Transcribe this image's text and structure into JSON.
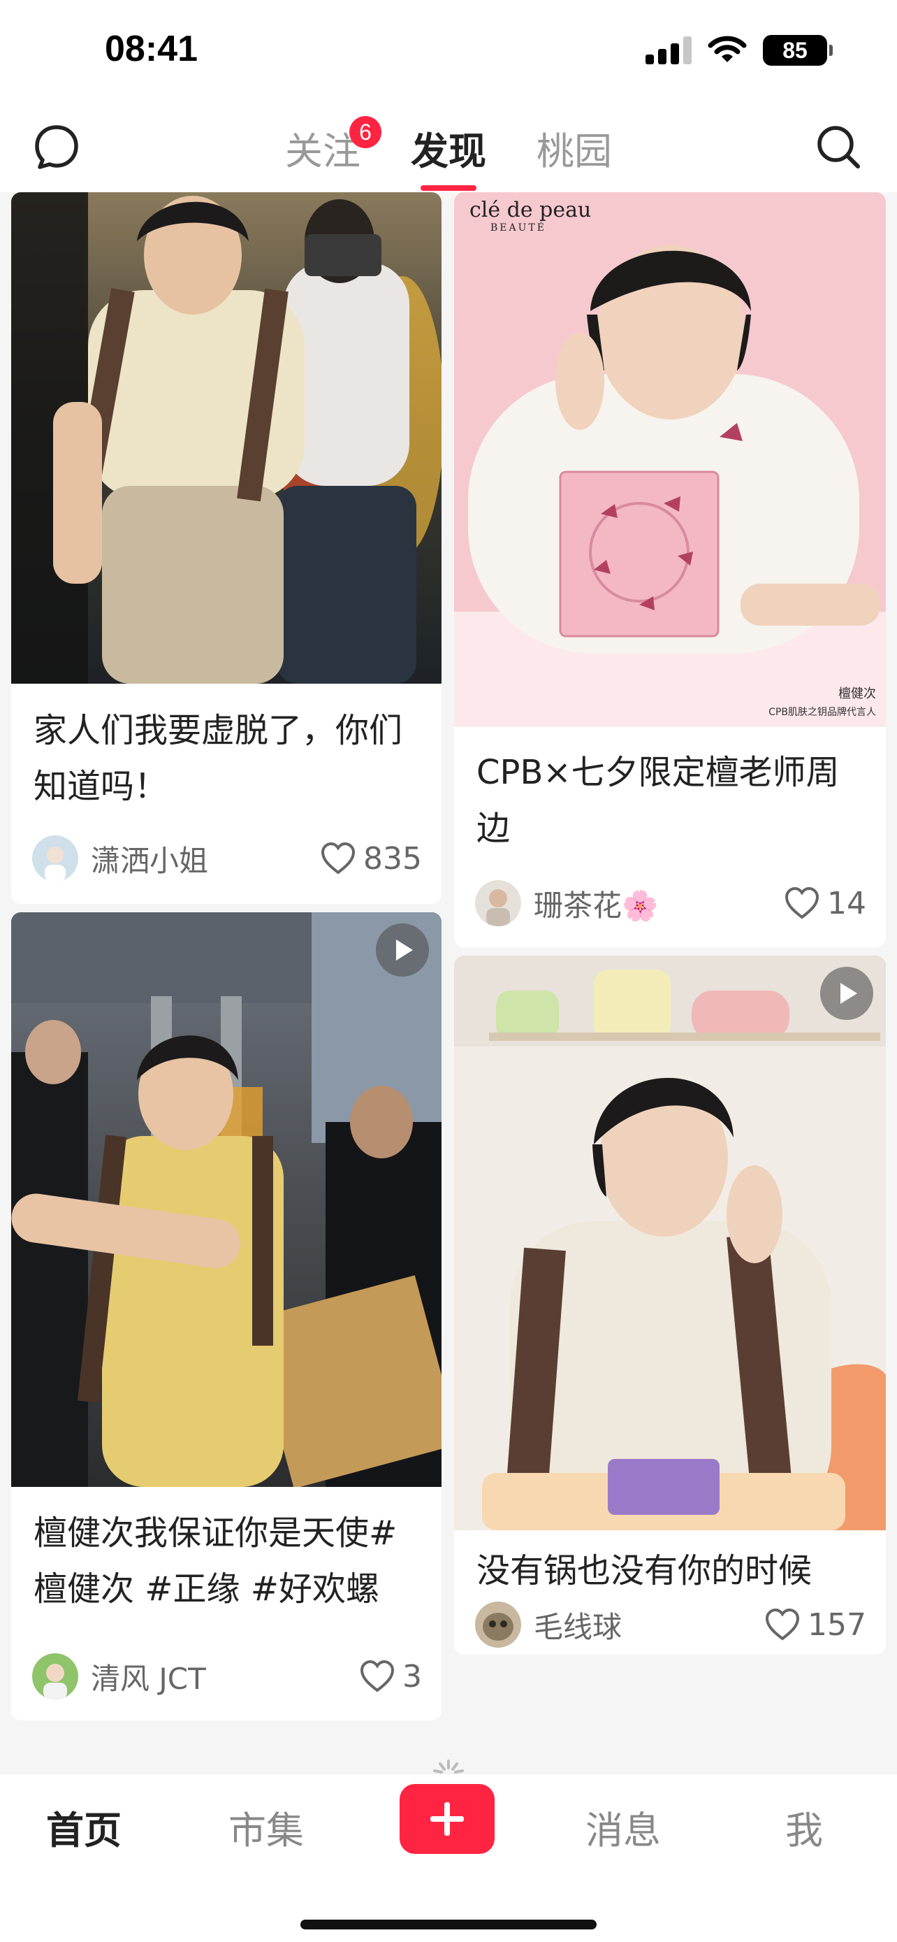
{
  "status_bar": {
    "time": "08:41",
    "battery": "85"
  },
  "top_nav": {
    "tabs": [
      {
        "label": "关注",
        "badge": "6"
      },
      {
        "label": "发现"
      },
      {
        "label": "桃园"
      }
    ],
    "active_tab": "发现"
  },
  "feed": {
    "posts": [
      {
        "title": "家人们我要虚脱了，你们知道吗！",
        "author": "潇洒小姐",
        "likes": "835",
        "video": false
      },
      {
        "brand_logo": "clé de peau",
        "brand_sub": "BEAUTÉ",
        "image_caption_1": "檀健次",
        "image_caption_2": "CPB肌肤之钥品牌代言人",
        "title": "CPB×七夕限定檀老师周边",
        "author": "珊茶花🌸",
        "likes": "14",
        "video": false
      },
      {
        "title": "檀健次我保证你是天使#檀健次 #正缘 #好欢螺",
        "author": "清风 JCT",
        "likes": "3",
        "video": true
      },
      {
        "title": "没有锅也没有你的时候",
        "author": "毛线球",
        "likes": "157",
        "video": true
      }
    ]
  },
  "tab_bar": {
    "items": [
      "首页",
      "市集",
      "消息",
      "我"
    ],
    "active": "首页"
  },
  "colors": {
    "accent": "#ff2442"
  }
}
